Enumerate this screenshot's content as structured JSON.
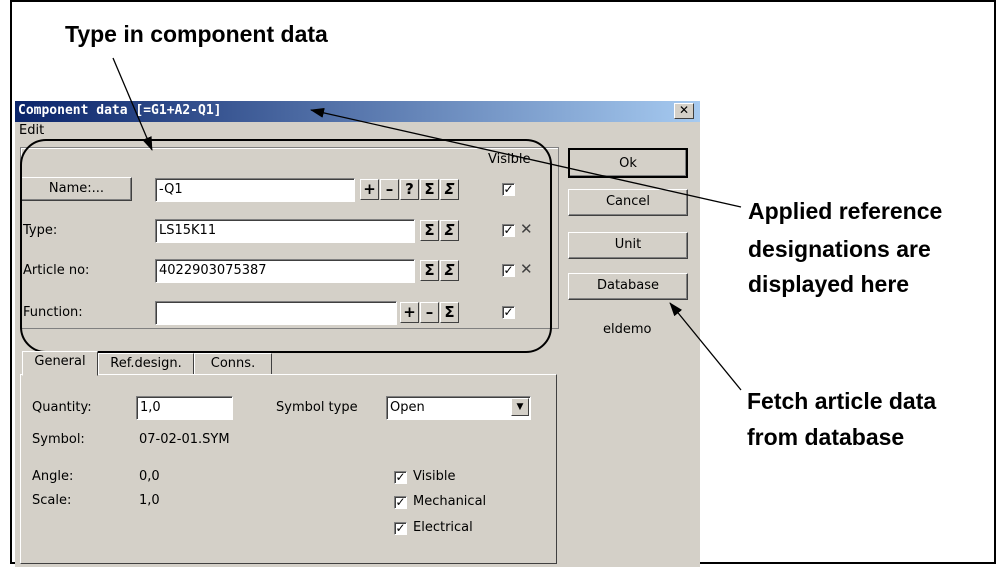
{
  "annotations": {
    "top": "Type in component data",
    "right1_line1": "Applied reference",
    "right1_line2": "designations are",
    "right1_line3": "displayed here",
    "right2_line1": "Fetch article data",
    "right2_line2": "from database"
  },
  "dialog": {
    "title": "Component data [=G1+A2-Q1]",
    "close_glyph": "✕",
    "menu": {
      "edit": "Edit"
    },
    "visible_header": "Visible",
    "fields": {
      "name": {
        "button": "Name:...",
        "accel": "N",
        "value": "-Q1"
      },
      "type": {
        "label": "Type:",
        "accel": "T",
        "value": "LS15K11"
      },
      "article": {
        "label": "Article no:",
        "accel": "A",
        "value": "4022903075387"
      },
      "function": {
        "label": "Function:",
        "accel": "F",
        "value": ""
      }
    },
    "small_buttons": {
      "plus": "+",
      "minus": "–",
      "question": "?",
      "sigma": "Σ",
      "sigma2": "Σ"
    },
    "check_glyph": "✓",
    "x_glyph": "✕",
    "side_buttons": {
      "ok": "Ok",
      "cancel": "Cancel",
      "unit": "Unit",
      "database": "Database",
      "db_name": "eldemo"
    },
    "tabs": [
      "General",
      "Ref.design.",
      "Conns."
    ],
    "general": {
      "quantity_label": "Quantity:",
      "quantity_value": "1,0",
      "symbol_type_label": "Symbol type",
      "symbol_type_value": "Open",
      "symbol_label": "Symbol:",
      "symbol_value": "07-02-01.SYM",
      "angle_label": "Angle:",
      "angle_value": "0,0",
      "scale_label": "Scale:",
      "scale_value": "1,0",
      "chk_visible": "Visible",
      "chk_mechanical": "Mechanical",
      "chk_electrical": "Electrical"
    }
  }
}
